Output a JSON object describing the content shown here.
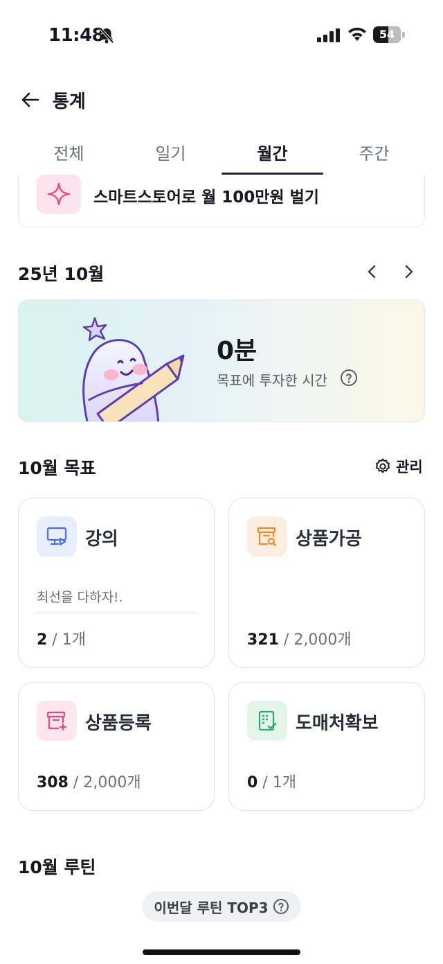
{
  "status_bar": {
    "time": "11:48",
    "battery": "54"
  },
  "header": {
    "title": "통계"
  },
  "tabs": [
    {
      "label": "전체",
      "active": false
    },
    {
      "label": "일기",
      "active": false
    },
    {
      "label": "월간",
      "active": true
    },
    {
      "label": "주간",
      "active": false
    }
  ],
  "goal_card": {
    "text": "스마트스토어로 월 100만원 벌기"
  },
  "month_nav": {
    "label": "25년 10월"
  },
  "summary": {
    "value": "0분",
    "caption": "목표에 투자한 시간"
  },
  "goals": {
    "title": "10월 목표",
    "manage_label": "관리",
    "items": [
      {
        "title": "강의",
        "note": "최선을 다하자!.",
        "current": "2",
        "total": "1개",
        "icon": "monitor-play-icon",
        "icon_color": "#4a6cf7",
        "bg": "#e9eefc"
      },
      {
        "title": "상품가공",
        "note": "",
        "current": "321",
        "total": "2,000개",
        "icon": "box-search-icon",
        "icon_color": "#f08a24",
        "bg": "#fdeee2"
      },
      {
        "title": "상품등록",
        "note": "",
        "current": "308",
        "total": "2,000개",
        "icon": "box-add-icon",
        "icon_color": "#e8487c",
        "bg": "#fde6ee"
      },
      {
        "title": "도매처확보",
        "note": "",
        "current": "0",
        "total": "1개",
        "icon": "checklist-icon",
        "icon_color": "#2ea868",
        "bg": "#e4f5ea"
      }
    ]
  },
  "routine": {
    "title": "10월 루틴",
    "top3_label": "이번달 루틴 TOP3"
  }
}
